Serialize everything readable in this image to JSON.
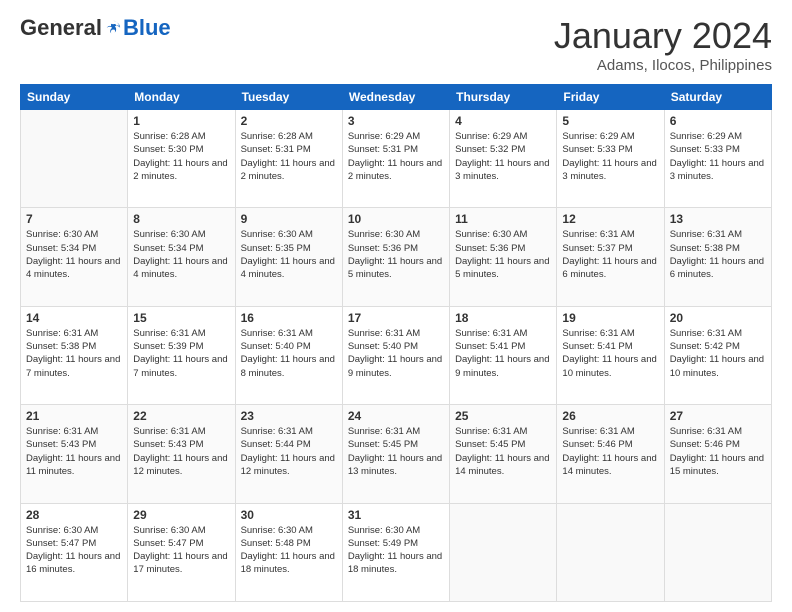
{
  "header": {
    "logo_general": "General",
    "logo_blue": "Blue",
    "month_title": "January 2024",
    "subtitle": "Adams, Ilocos, Philippines"
  },
  "days_of_week": [
    "Sunday",
    "Monday",
    "Tuesday",
    "Wednesday",
    "Thursday",
    "Friday",
    "Saturday"
  ],
  "weeks": [
    [
      {
        "day": "",
        "sunrise": "",
        "sunset": "",
        "daylight": ""
      },
      {
        "day": "1",
        "sunrise": "Sunrise: 6:28 AM",
        "sunset": "Sunset: 5:30 PM",
        "daylight": "Daylight: 11 hours and 2 minutes."
      },
      {
        "day": "2",
        "sunrise": "Sunrise: 6:28 AM",
        "sunset": "Sunset: 5:31 PM",
        "daylight": "Daylight: 11 hours and 2 minutes."
      },
      {
        "day": "3",
        "sunrise": "Sunrise: 6:29 AM",
        "sunset": "Sunset: 5:31 PM",
        "daylight": "Daylight: 11 hours and 2 minutes."
      },
      {
        "day": "4",
        "sunrise": "Sunrise: 6:29 AM",
        "sunset": "Sunset: 5:32 PM",
        "daylight": "Daylight: 11 hours and 3 minutes."
      },
      {
        "day": "5",
        "sunrise": "Sunrise: 6:29 AM",
        "sunset": "Sunset: 5:33 PM",
        "daylight": "Daylight: 11 hours and 3 minutes."
      },
      {
        "day": "6",
        "sunrise": "Sunrise: 6:29 AM",
        "sunset": "Sunset: 5:33 PM",
        "daylight": "Daylight: 11 hours and 3 minutes."
      }
    ],
    [
      {
        "day": "7",
        "sunrise": "Sunrise: 6:30 AM",
        "sunset": "Sunset: 5:34 PM",
        "daylight": "Daylight: 11 hours and 4 minutes."
      },
      {
        "day": "8",
        "sunrise": "Sunrise: 6:30 AM",
        "sunset": "Sunset: 5:34 PM",
        "daylight": "Daylight: 11 hours and 4 minutes."
      },
      {
        "day": "9",
        "sunrise": "Sunrise: 6:30 AM",
        "sunset": "Sunset: 5:35 PM",
        "daylight": "Daylight: 11 hours and 4 minutes."
      },
      {
        "day": "10",
        "sunrise": "Sunrise: 6:30 AM",
        "sunset": "Sunset: 5:36 PM",
        "daylight": "Daylight: 11 hours and 5 minutes."
      },
      {
        "day": "11",
        "sunrise": "Sunrise: 6:30 AM",
        "sunset": "Sunset: 5:36 PM",
        "daylight": "Daylight: 11 hours and 5 minutes."
      },
      {
        "day": "12",
        "sunrise": "Sunrise: 6:31 AM",
        "sunset": "Sunset: 5:37 PM",
        "daylight": "Daylight: 11 hours and 6 minutes."
      },
      {
        "day": "13",
        "sunrise": "Sunrise: 6:31 AM",
        "sunset": "Sunset: 5:38 PM",
        "daylight": "Daylight: 11 hours and 6 minutes."
      }
    ],
    [
      {
        "day": "14",
        "sunrise": "Sunrise: 6:31 AM",
        "sunset": "Sunset: 5:38 PM",
        "daylight": "Daylight: 11 hours and 7 minutes."
      },
      {
        "day": "15",
        "sunrise": "Sunrise: 6:31 AM",
        "sunset": "Sunset: 5:39 PM",
        "daylight": "Daylight: 11 hours and 7 minutes."
      },
      {
        "day": "16",
        "sunrise": "Sunrise: 6:31 AM",
        "sunset": "Sunset: 5:40 PM",
        "daylight": "Daylight: 11 hours and 8 minutes."
      },
      {
        "day": "17",
        "sunrise": "Sunrise: 6:31 AM",
        "sunset": "Sunset: 5:40 PM",
        "daylight": "Daylight: 11 hours and 9 minutes."
      },
      {
        "day": "18",
        "sunrise": "Sunrise: 6:31 AM",
        "sunset": "Sunset: 5:41 PM",
        "daylight": "Daylight: 11 hours and 9 minutes."
      },
      {
        "day": "19",
        "sunrise": "Sunrise: 6:31 AM",
        "sunset": "Sunset: 5:41 PM",
        "daylight": "Daylight: 11 hours and 10 minutes."
      },
      {
        "day": "20",
        "sunrise": "Sunrise: 6:31 AM",
        "sunset": "Sunset: 5:42 PM",
        "daylight": "Daylight: 11 hours and 10 minutes."
      }
    ],
    [
      {
        "day": "21",
        "sunrise": "Sunrise: 6:31 AM",
        "sunset": "Sunset: 5:43 PM",
        "daylight": "Daylight: 11 hours and 11 minutes."
      },
      {
        "day": "22",
        "sunrise": "Sunrise: 6:31 AM",
        "sunset": "Sunset: 5:43 PM",
        "daylight": "Daylight: 11 hours and 12 minutes."
      },
      {
        "day": "23",
        "sunrise": "Sunrise: 6:31 AM",
        "sunset": "Sunset: 5:44 PM",
        "daylight": "Daylight: 11 hours and 12 minutes."
      },
      {
        "day": "24",
        "sunrise": "Sunrise: 6:31 AM",
        "sunset": "Sunset: 5:45 PM",
        "daylight": "Daylight: 11 hours and 13 minutes."
      },
      {
        "day": "25",
        "sunrise": "Sunrise: 6:31 AM",
        "sunset": "Sunset: 5:45 PM",
        "daylight": "Daylight: 11 hours and 14 minutes."
      },
      {
        "day": "26",
        "sunrise": "Sunrise: 6:31 AM",
        "sunset": "Sunset: 5:46 PM",
        "daylight": "Daylight: 11 hours and 14 minutes."
      },
      {
        "day": "27",
        "sunrise": "Sunrise: 6:31 AM",
        "sunset": "Sunset: 5:46 PM",
        "daylight": "Daylight: 11 hours and 15 minutes."
      }
    ],
    [
      {
        "day": "28",
        "sunrise": "Sunrise: 6:30 AM",
        "sunset": "Sunset: 5:47 PM",
        "daylight": "Daylight: 11 hours and 16 minutes."
      },
      {
        "day": "29",
        "sunrise": "Sunrise: 6:30 AM",
        "sunset": "Sunset: 5:47 PM",
        "daylight": "Daylight: 11 hours and 17 minutes."
      },
      {
        "day": "30",
        "sunrise": "Sunrise: 6:30 AM",
        "sunset": "Sunset: 5:48 PM",
        "daylight": "Daylight: 11 hours and 18 minutes."
      },
      {
        "day": "31",
        "sunrise": "Sunrise: 6:30 AM",
        "sunset": "Sunset: 5:49 PM",
        "daylight": "Daylight: 11 hours and 18 minutes."
      },
      {
        "day": "",
        "sunrise": "",
        "sunset": "",
        "daylight": ""
      },
      {
        "day": "",
        "sunrise": "",
        "sunset": "",
        "daylight": ""
      },
      {
        "day": "",
        "sunrise": "",
        "sunset": "",
        "daylight": ""
      }
    ]
  ]
}
